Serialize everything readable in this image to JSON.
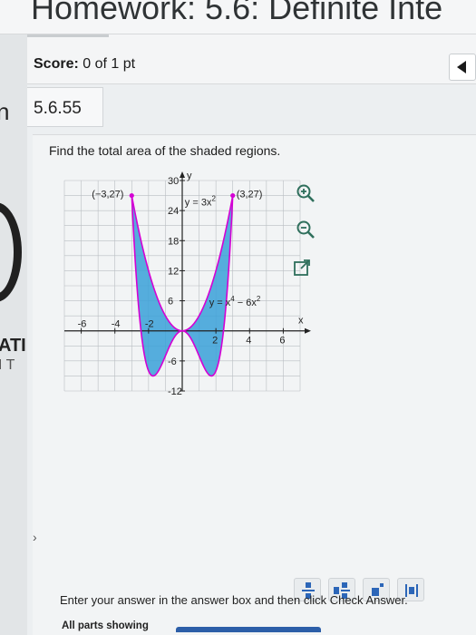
{
  "window": {
    "title": "Homework: 5.6: Definite Inte"
  },
  "sidebar": {
    "letter": "n",
    "word1": "ATI",
    "word2": "I T"
  },
  "score": {
    "label": "Score:",
    "value": "0 of 1 pt"
  },
  "question": {
    "id": "5.6.55",
    "prompt": "Find the total area of the shaded regions."
  },
  "chart_data": {
    "type": "line",
    "x_axis_label": "x",
    "y_axis_label": "y",
    "xlim": [
      -7,
      7
    ],
    "ylim": [
      -12,
      30
    ],
    "x_ticks": [
      -6,
      -4,
      -2,
      2,
      4,
      6
    ],
    "y_ticks": [
      30,
      24,
      18,
      12,
      6,
      -6,
      -12
    ],
    "grid": true,
    "series": [
      {
        "name": "y = 3x²",
        "function": "3*x^2",
        "domain": [
          -3,
          3
        ],
        "color": "#d400d4"
      },
      {
        "name": "y = x⁴ − 6x²",
        "function": "x^4 - 6*x^2",
        "domain": [
          -3,
          3
        ],
        "color": "#d400d4"
      }
    ],
    "shaded_region": {
      "between": [
        "3*x^2",
        "x^4 - 6*x^2"
      ],
      "x_range": [
        -3,
        3
      ],
      "color": "#3aa0d8"
    },
    "points": [
      {
        "label": "(−3,27)",
        "x": -3,
        "y": 27
      },
      {
        "label": "(3,27)",
        "x": 3,
        "y": 27
      }
    ],
    "annotations": {
      "curve1": {
        "base": "y = 3x",
        "exp": "2"
      },
      "curve2": {
        "base": "y = x",
        "exp1": "4",
        "mid": " − 6x",
        "exp2": "2"
      }
    }
  },
  "tools": {
    "zoom_in": "zoom-in-icon",
    "zoom_out": "zoom-out-icon",
    "popout": "open-new-window-icon"
  },
  "footer": {
    "instruction": "Enter your answer in the answer box and then click Check Answer.",
    "parts": "All parts showing"
  },
  "colors": {
    "accent": "#2c66b8",
    "curve": "#d400d4",
    "shade": "#3aa0d8"
  }
}
